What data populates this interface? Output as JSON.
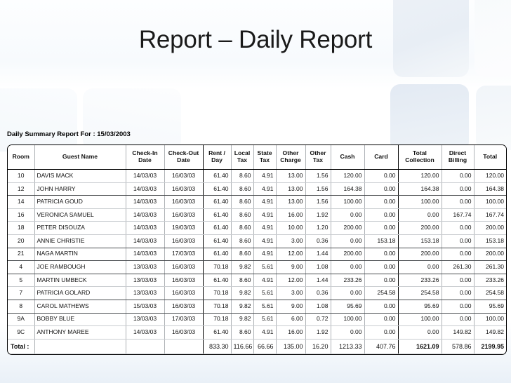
{
  "slide": {
    "title": "Report – Daily Report"
  },
  "report": {
    "caption_prefix": "Daily Summary Report For :",
    "caption_date": "15/03/2003",
    "caption": "Daily Summary Report For : 15/03/2003",
    "columns": [
      "Room",
      "Guest Name",
      "Check-In Date",
      "Check-Out Date",
      "Rent / Day",
      "Local Tax",
      "State Tax",
      "Other Charge",
      "Other Tax",
      "Cash",
      "Card",
      "Total Collection",
      "Direct Billing",
      "Total"
    ],
    "rows": [
      {
        "room": "10",
        "guest": "DAVIS MACK",
        "checkin": "14/03/03",
        "checkout": "16/03/03",
        "rent": "61.40",
        "local_tax": "8.60",
        "state_tax": "4.91",
        "other_charge": "13.00",
        "other_tax": "1.56",
        "cash": "120.00",
        "card": "0.00",
        "total_collection": "120.00",
        "direct_billing": "0.00",
        "total": "120.00"
      },
      {
        "room": "12",
        "guest": "JOHN HARRY",
        "checkin": "14/03/03",
        "checkout": "16/03/03",
        "rent": "61.40",
        "local_tax": "8.60",
        "state_tax": "4.91",
        "other_charge": "13.00",
        "other_tax": "1.56",
        "cash": "164.38",
        "card": "0.00",
        "total_collection": "164.38",
        "direct_billing": "0.00",
        "total": "164.38"
      },
      {
        "room": "14",
        "guest": "PATRICIA GOUD",
        "checkin": "14/03/03",
        "checkout": "16/03/03",
        "rent": "61.40",
        "local_tax": "8.60",
        "state_tax": "4.91",
        "other_charge": "13.00",
        "other_tax": "1.56",
        "cash": "100.00",
        "card": "0.00",
        "total_collection": "100.00",
        "direct_billing": "0.00",
        "total": "100.00"
      },
      {
        "room": "16",
        "guest": "VERONICA SAMUEL",
        "checkin": "14/03/03",
        "checkout": "16/03/03",
        "rent": "61.40",
        "local_tax": "8.60",
        "state_tax": "4.91",
        "other_charge": "16.00",
        "other_tax": "1.92",
        "cash": "0.00",
        "card": "0.00",
        "total_collection": "0.00",
        "direct_billing": "167.74",
        "total": "167.74"
      },
      {
        "room": "18",
        "guest": "PETER DISOUZA",
        "checkin": "14/03/03",
        "checkout": "19/03/03",
        "rent": "61.40",
        "local_tax": "8.60",
        "state_tax": "4.91",
        "other_charge": "10.00",
        "other_tax": "1.20",
        "cash": "200.00",
        "card": "0.00",
        "total_collection": "200.00",
        "direct_billing": "0.00",
        "total": "200.00"
      },
      {
        "room": "20",
        "guest": "ANNIE CHRISTIE",
        "checkin": "14/03/03",
        "checkout": "16/03/03",
        "rent": "61.40",
        "local_tax": "8.60",
        "state_tax": "4.91",
        "other_charge": "3.00",
        "other_tax": "0.36",
        "cash": "0.00",
        "card": "153.18",
        "total_collection": "153.18",
        "direct_billing": "0.00",
        "total": "153.18"
      },
      {
        "room": "21",
        "guest": "NAGA MARTIN",
        "checkin": "14/03/03",
        "checkout": "17/03/03",
        "rent": "61.40",
        "local_tax": "8.60",
        "state_tax": "4.91",
        "other_charge": "12.00",
        "other_tax": "1.44",
        "cash": "200.00",
        "card": "0.00",
        "total_collection": "200.00",
        "direct_billing": "0.00",
        "total": "200.00"
      },
      {
        "room": "4",
        "guest": "JOE RAMBOUGH",
        "checkin": "13/03/03",
        "checkout": "16/03/03",
        "rent": "70.18",
        "local_tax": "9.82",
        "state_tax": "5.61",
        "other_charge": "9.00",
        "other_tax": "1.08",
        "cash": "0.00",
        "card": "0.00",
        "total_collection": "0.00",
        "direct_billing": "261.30",
        "total": "261.30"
      },
      {
        "room": "5",
        "guest": "MARTIN UMBECK",
        "checkin": "13/03/03",
        "checkout": "16/03/03",
        "rent": "61.40",
        "local_tax": "8.60",
        "state_tax": "4.91",
        "other_charge": "12.00",
        "other_tax": "1.44",
        "cash": "233.26",
        "card": "0.00",
        "total_collection": "233.26",
        "direct_billing": "0.00",
        "total": "233.26"
      },
      {
        "room": "7",
        "guest": "PATRICIA GOLARD",
        "checkin": "13/03/03",
        "checkout": "16/03/03",
        "rent": "70.18",
        "local_tax": "9.82",
        "state_tax": "5.61",
        "other_charge": "3.00",
        "other_tax": "0.36",
        "cash": "0.00",
        "card": "254.58",
        "total_collection": "254.58",
        "direct_billing": "0.00",
        "total": "254.58"
      },
      {
        "room": "8",
        "guest": "CAROL MATHEWS",
        "checkin": "15/03/03",
        "checkout": "16/03/03",
        "rent": "70.18",
        "local_tax": "9.82",
        "state_tax": "5.61",
        "other_charge": "9.00",
        "other_tax": "1.08",
        "cash": "95.69",
        "card": "0.00",
        "total_collection": "95.69",
        "direct_billing": "0.00",
        "total": "95.69"
      },
      {
        "room": "9A",
        "guest": "BOBBY BLUE",
        "checkin": "13/03/03",
        "checkout": "17/03/03",
        "rent": "70.18",
        "local_tax": "9.82",
        "state_tax": "5.61",
        "other_charge": "6.00",
        "other_tax": "0.72",
        "cash": "100.00",
        "card": "0.00",
        "total_collection": "100.00",
        "direct_billing": "0.00",
        "total": "100.00"
      },
      {
        "room": "9C",
        "guest": "ANTHONY MAREE",
        "checkin": "14/03/03",
        "checkout": "16/03/03",
        "rent": "61.40",
        "local_tax": "8.60",
        "state_tax": "4.91",
        "other_charge": "16.00",
        "other_tax": "1.92",
        "cash": "0.00",
        "card": "0.00",
        "total_collection": "0.00",
        "direct_billing": "149.82",
        "total": "149.82"
      }
    ],
    "totals": {
      "label": "Total :",
      "rent": "833.30",
      "local_tax": "116.66",
      "state_tax": "66.66",
      "other_charge": "135.00",
      "other_tax": "16.20",
      "cash": "1213.33",
      "card": "407.76",
      "total_collection": "1621.09",
      "direct_billing": "578.86",
      "total": "2199.95"
    }
  }
}
